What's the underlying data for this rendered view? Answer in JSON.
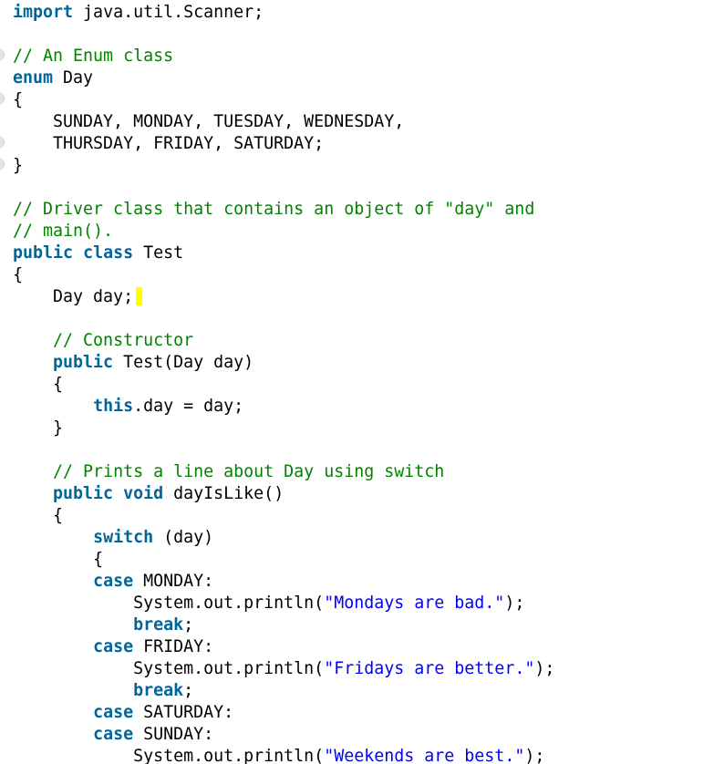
{
  "code": {
    "language": "java",
    "lines": [
      [
        {
          "t": "kw",
          "v": "import"
        },
        {
          "t": "tx",
          "v": " java.util.Scanner;"
        }
      ],
      [],
      [
        {
          "t": "cm",
          "v": "// An Enum class"
        }
      ],
      [
        {
          "t": "kw",
          "v": "enum"
        },
        {
          "t": "tx",
          "v": " Day"
        }
      ],
      [
        {
          "t": "tx",
          "v": "{"
        }
      ],
      [
        {
          "t": "tx",
          "v": "    SUNDAY, MONDAY, TUESDAY, WEDNESDAY,"
        }
      ],
      [
        {
          "t": "tx",
          "v": "    THURSDAY, FRIDAY, SATURDAY;"
        }
      ],
      [
        {
          "t": "tx",
          "v": "}"
        }
      ],
      [],
      [
        {
          "t": "cm",
          "v": "// Driver class that contains an object of \"day\" and"
        }
      ],
      [
        {
          "t": "cm",
          "v": "// main()."
        }
      ],
      [
        {
          "t": "kw",
          "v": "public"
        },
        {
          "t": "tx",
          "v": " "
        },
        {
          "t": "kw",
          "v": "class"
        },
        {
          "t": "tx",
          "v": " Test"
        }
      ],
      [
        {
          "t": "tx",
          "v": "{"
        }
      ],
      [
        {
          "t": "tx",
          "v": "    Day day;"
        },
        {
          "t": "cursor",
          "v": ""
        }
      ],
      [],
      [
        {
          "t": "tx",
          "v": "    "
        },
        {
          "t": "cm",
          "v": "// Constructor"
        }
      ],
      [
        {
          "t": "tx",
          "v": "    "
        },
        {
          "t": "kw",
          "v": "public"
        },
        {
          "t": "tx",
          "v": " Test(Day day)"
        }
      ],
      [
        {
          "t": "tx",
          "v": "    {"
        }
      ],
      [
        {
          "t": "tx",
          "v": "        "
        },
        {
          "t": "kw",
          "v": "this"
        },
        {
          "t": "tx",
          "v": ".day = day;"
        }
      ],
      [
        {
          "t": "tx",
          "v": "    }"
        }
      ],
      [],
      [
        {
          "t": "tx",
          "v": "    "
        },
        {
          "t": "cm",
          "v": "// Prints a line about Day using switch"
        }
      ],
      [
        {
          "t": "tx",
          "v": "    "
        },
        {
          "t": "kw",
          "v": "public"
        },
        {
          "t": "tx",
          "v": " "
        },
        {
          "t": "kw",
          "v": "void"
        },
        {
          "t": "tx",
          "v": " dayIsLike()"
        }
      ],
      [
        {
          "t": "tx",
          "v": "    {"
        }
      ],
      [
        {
          "t": "tx",
          "v": "        "
        },
        {
          "t": "kw",
          "v": "switch"
        },
        {
          "t": "tx",
          "v": " (day)"
        }
      ],
      [
        {
          "t": "tx",
          "v": "        {"
        }
      ],
      [
        {
          "t": "tx",
          "v": "        "
        },
        {
          "t": "kw",
          "v": "case"
        },
        {
          "t": "tx",
          "v": " MONDAY:"
        }
      ],
      [
        {
          "t": "tx",
          "v": "            System.out.println("
        },
        {
          "t": "st",
          "v": "\"Mondays are bad.\""
        },
        {
          "t": "tx",
          "v": ");"
        }
      ],
      [
        {
          "t": "tx",
          "v": "            "
        },
        {
          "t": "kw",
          "v": "break"
        },
        {
          "t": "tx",
          "v": ";"
        }
      ],
      [
        {
          "t": "tx",
          "v": "        "
        },
        {
          "t": "kw",
          "v": "case"
        },
        {
          "t": "tx",
          "v": " FRIDAY:"
        }
      ],
      [
        {
          "t": "tx",
          "v": "            System.out.println("
        },
        {
          "t": "st",
          "v": "\"Fridays are better.\""
        },
        {
          "t": "tx",
          "v": ");"
        }
      ],
      [
        {
          "t": "tx",
          "v": "            "
        },
        {
          "t": "kw",
          "v": "break"
        },
        {
          "t": "tx",
          "v": ";"
        }
      ],
      [
        {
          "t": "tx",
          "v": "        "
        },
        {
          "t": "kw",
          "v": "case"
        },
        {
          "t": "tx",
          "v": " SATURDAY:"
        }
      ],
      [
        {
          "t": "tx",
          "v": "        "
        },
        {
          "t": "kw",
          "v": "case"
        },
        {
          "t": "tx",
          "v": " SUNDAY:"
        }
      ],
      [
        {
          "t": "tx",
          "v": "            System.out.println("
        },
        {
          "t": "st",
          "v": "\"Weekends are best.\""
        },
        {
          "t": "tx",
          "v": ");"
        }
      ]
    ]
  },
  "cursor_color": "#ffff00",
  "colors": {
    "keyword": "#006699",
    "comment": "#008200",
    "string": "#0000ff",
    "text": "#000000",
    "background": "#ffffff"
  }
}
